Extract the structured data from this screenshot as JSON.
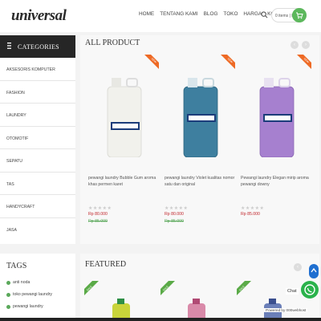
{
  "header": {
    "logo": "universal",
    "nav": [
      "HOME",
      "TENTANG KAMI",
      "BLOG",
      "TOKO",
      "HARGA",
      "KONTAK"
    ],
    "cart_text": "0 items | Rp 0"
  },
  "sidebar": {
    "title": "CATEGORIES",
    "items": [
      "AKSESORIS KOMPUTER",
      "FASHION",
      "LAUNDRY",
      "OTOMOTIF",
      "SEPATU",
      "TAS",
      "HANDYCRAFT",
      "JASA"
    ]
  },
  "tags": {
    "title": "TAGS",
    "items": [
      "anti noda",
      "toko pewangi laundry",
      "pewangi laundry"
    ]
  },
  "all_product": {
    "title": "ALL PRODUCT",
    "ribbon": "NEW",
    "products": [
      {
        "name": "pewangi laundry Bubble Gum aroma khas permen karet",
        "price": "Rp 80.000",
        "old_price": "Rp 85.000",
        "liquid_color": "#f4f3ee"
      },
      {
        "name": "pewangi laundry Violet kualitas nomor satu dan original",
        "price": "Rp 80.000",
        "old_price": "Rp 85.000",
        "liquid_color": "#3f82a3"
      },
      {
        "name": "Pewangi laundry Elegan mirip aroma pewangi downy",
        "price": "Rp 85.000",
        "old_price": "",
        "liquid_color": "#a57fcf"
      }
    ]
  },
  "featured": {
    "title": "FEATURED",
    "ribbon": "SALE"
  },
  "widgets": {
    "chat": "Chat",
    "powered": "Powered by 000webhost"
  }
}
